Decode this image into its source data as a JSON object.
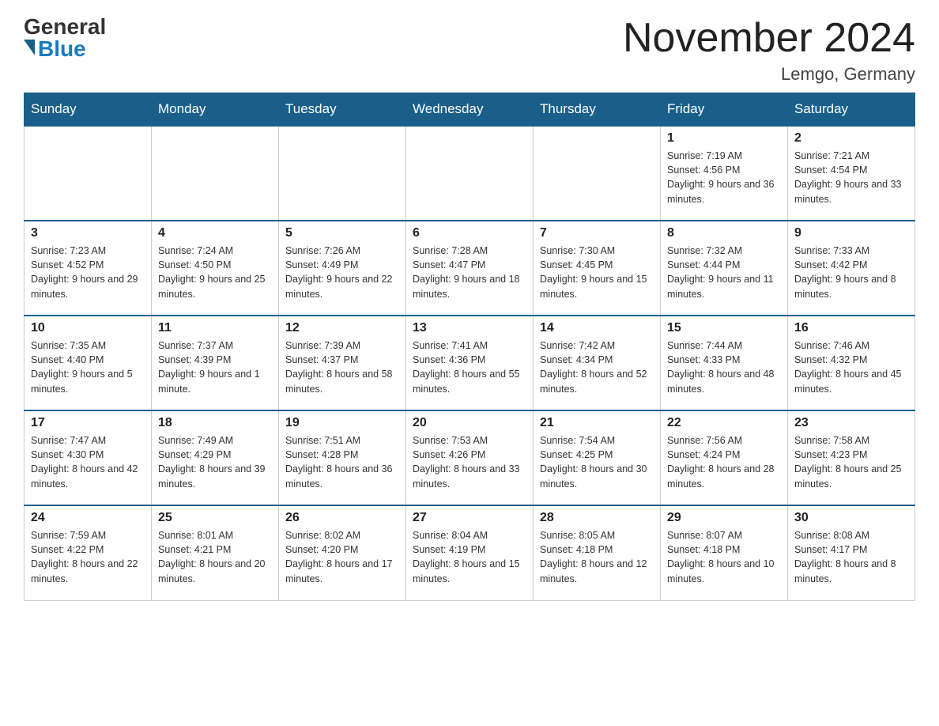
{
  "header": {
    "logo_general": "General",
    "logo_blue": "Blue",
    "month_title": "November 2024",
    "location": "Lemgo, Germany"
  },
  "weekdays": [
    "Sunday",
    "Monday",
    "Tuesday",
    "Wednesday",
    "Thursday",
    "Friday",
    "Saturday"
  ],
  "weeks": [
    [
      {
        "day": "",
        "info": ""
      },
      {
        "day": "",
        "info": ""
      },
      {
        "day": "",
        "info": ""
      },
      {
        "day": "",
        "info": ""
      },
      {
        "day": "",
        "info": ""
      },
      {
        "day": "1",
        "info": "Sunrise: 7:19 AM\nSunset: 4:56 PM\nDaylight: 9 hours and 36 minutes."
      },
      {
        "day": "2",
        "info": "Sunrise: 7:21 AM\nSunset: 4:54 PM\nDaylight: 9 hours and 33 minutes."
      }
    ],
    [
      {
        "day": "3",
        "info": "Sunrise: 7:23 AM\nSunset: 4:52 PM\nDaylight: 9 hours and 29 minutes."
      },
      {
        "day": "4",
        "info": "Sunrise: 7:24 AM\nSunset: 4:50 PM\nDaylight: 9 hours and 25 minutes."
      },
      {
        "day": "5",
        "info": "Sunrise: 7:26 AM\nSunset: 4:49 PM\nDaylight: 9 hours and 22 minutes."
      },
      {
        "day": "6",
        "info": "Sunrise: 7:28 AM\nSunset: 4:47 PM\nDaylight: 9 hours and 18 minutes."
      },
      {
        "day": "7",
        "info": "Sunrise: 7:30 AM\nSunset: 4:45 PM\nDaylight: 9 hours and 15 minutes."
      },
      {
        "day": "8",
        "info": "Sunrise: 7:32 AM\nSunset: 4:44 PM\nDaylight: 9 hours and 11 minutes."
      },
      {
        "day": "9",
        "info": "Sunrise: 7:33 AM\nSunset: 4:42 PM\nDaylight: 9 hours and 8 minutes."
      }
    ],
    [
      {
        "day": "10",
        "info": "Sunrise: 7:35 AM\nSunset: 4:40 PM\nDaylight: 9 hours and 5 minutes."
      },
      {
        "day": "11",
        "info": "Sunrise: 7:37 AM\nSunset: 4:39 PM\nDaylight: 9 hours and 1 minute."
      },
      {
        "day": "12",
        "info": "Sunrise: 7:39 AM\nSunset: 4:37 PM\nDaylight: 8 hours and 58 minutes."
      },
      {
        "day": "13",
        "info": "Sunrise: 7:41 AM\nSunset: 4:36 PM\nDaylight: 8 hours and 55 minutes."
      },
      {
        "day": "14",
        "info": "Sunrise: 7:42 AM\nSunset: 4:34 PM\nDaylight: 8 hours and 52 minutes."
      },
      {
        "day": "15",
        "info": "Sunrise: 7:44 AM\nSunset: 4:33 PM\nDaylight: 8 hours and 48 minutes."
      },
      {
        "day": "16",
        "info": "Sunrise: 7:46 AM\nSunset: 4:32 PM\nDaylight: 8 hours and 45 minutes."
      }
    ],
    [
      {
        "day": "17",
        "info": "Sunrise: 7:47 AM\nSunset: 4:30 PM\nDaylight: 8 hours and 42 minutes."
      },
      {
        "day": "18",
        "info": "Sunrise: 7:49 AM\nSunset: 4:29 PM\nDaylight: 8 hours and 39 minutes."
      },
      {
        "day": "19",
        "info": "Sunrise: 7:51 AM\nSunset: 4:28 PM\nDaylight: 8 hours and 36 minutes."
      },
      {
        "day": "20",
        "info": "Sunrise: 7:53 AM\nSunset: 4:26 PM\nDaylight: 8 hours and 33 minutes."
      },
      {
        "day": "21",
        "info": "Sunrise: 7:54 AM\nSunset: 4:25 PM\nDaylight: 8 hours and 30 minutes."
      },
      {
        "day": "22",
        "info": "Sunrise: 7:56 AM\nSunset: 4:24 PM\nDaylight: 8 hours and 28 minutes."
      },
      {
        "day": "23",
        "info": "Sunrise: 7:58 AM\nSunset: 4:23 PM\nDaylight: 8 hours and 25 minutes."
      }
    ],
    [
      {
        "day": "24",
        "info": "Sunrise: 7:59 AM\nSunset: 4:22 PM\nDaylight: 8 hours and 22 minutes."
      },
      {
        "day": "25",
        "info": "Sunrise: 8:01 AM\nSunset: 4:21 PM\nDaylight: 8 hours and 20 minutes."
      },
      {
        "day": "26",
        "info": "Sunrise: 8:02 AM\nSunset: 4:20 PM\nDaylight: 8 hours and 17 minutes."
      },
      {
        "day": "27",
        "info": "Sunrise: 8:04 AM\nSunset: 4:19 PM\nDaylight: 8 hours and 15 minutes."
      },
      {
        "day": "28",
        "info": "Sunrise: 8:05 AM\nSunset: 4:18 PM\nDaylight: 8 hours and 12 minutes."
      },
      {
        "day": "29",
        "info": "Sunrise: 8:07 AM\nSunset: 4:18 PM\nDaylight: 8 hours and 10 minutes."
      },
      {
        "day": "30",
        "info": "Sunrise: 8:08 AM\nSunset: 4:17 PM\nDaylight: 8 hours and 8 minutes."
      }
    ]
  ]
}
